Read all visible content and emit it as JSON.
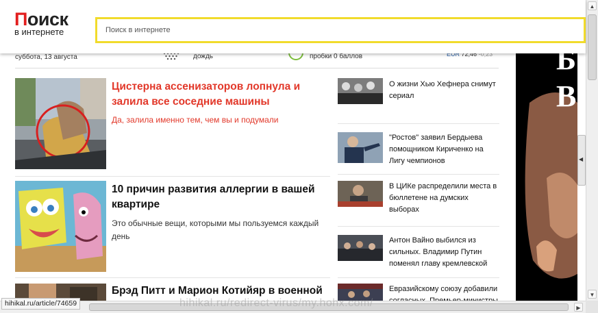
{
  "header": {
    "logo_top": "Поиск",
    "logo_bottom": "в интернете",
    "search_placeholder": "Поиск в интернете"
  },
  "info": {
    "date": "суббота, 13 августа",
    "weather": "дождь",
    "traffic": "пробки 0 баллов",
    "currency_name": "EUR",
    "currency_value": "72,46",
    "currency_delta": "-0,23"
  },
  "main_news": [
    {
      "title": "Цистерна ассенизаторов лопнула и залила все соседние машины",
      "desc": "Да, залила именно тем, чем вы и подумали"
    },
    {
      "title": "10 причин развития аллергии в вашей квартире",
      "desc": "Это обычные вещи, которыми мы пользуемся каждый день"
    },
    {
      "title": "Брэд Питт и Марион Котийяр в военной",
      "desc": ""
    }
  ],
  "side_news": [
    {
      "title": "О жизни Хью Хефнера снимут сериал"
    },
    {
      "title": "\"Ростов\" заявил Бердыева помощником Кириченко на Лигу чемпионов"
    },
    {
      "title": "В ЦИКе распределили места в бюллетене на думских выборах"
    },
    {
      "title": "Антон Вайно выбился из сильных. Владимир Путин поменял главу кремлевской"
    },
    {
      "title": "Евразийскому союзу добавили согласных. Премьер-министры"
    }
  ],
  "ad": {
    "letter_1": "Б",
    "letter_2": "В"
  },
  "status_url": "hihikal.ru/article/74659",
  "watermark": "hihikal.ru/redirect-virus/my.hohx.com/",
  "colors": {
    "accent_red": "#e2382a",
    "search_border": "#f1db2b",
    "traffic_green": "#7cbd3c"
  }
}
